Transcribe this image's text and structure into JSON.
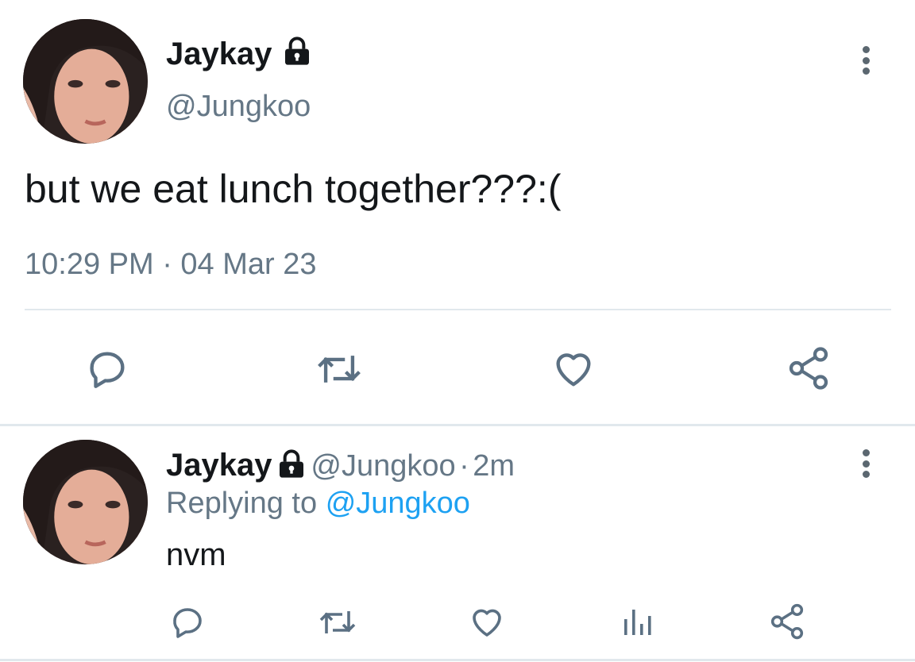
{
  "main_tweet": {
    "display_name": "Jaykay",
    "handle": "@Jungkoo",
    "text": "but we eat lunch together???:(",
    "timestamp": "10:29 PM · 04 Mar 23",
    "protected_icon": "lock-icon",
    "actions": [
      "reply-icon",
      "retweet-icon",
      "like-icon",
      "share-icon"
    ]
  },
  "reply_tweet": {
    "display_name": "Jaykay",
    "handle": "@Jungkoo",
    "separator": "·",
    "age": "2m",
    "replying_prefix": "Replying to",
    "replying_handle": "@Jungkoo",
    "text": "nvm",
    "protected_icon": "lock-icon",
    "actions": [
      "reply-icon",
      "retweet-icon",
      "like-icon",
      "analytics-icon",
      "share-icon"
    ]
  },
  "colors": {
    "text": "#14171a",
    "secondary": "#657786",
    "link": "#1da1f2",
    "icon": "#5b7083",
    "divider": "#e1e8ed"
  }
}
